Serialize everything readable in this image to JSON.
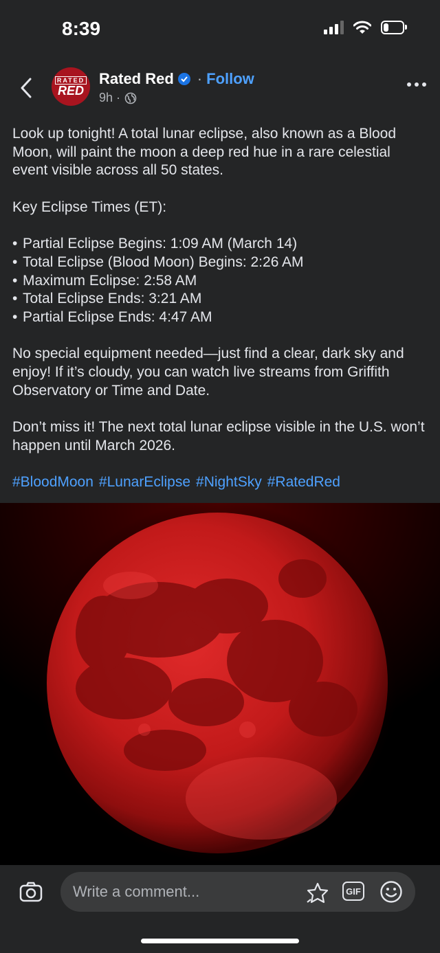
{
  "status_bar": {
    "time": "8:39",
    "battery_level": 0.25
  },
  "header": {
    "avatar_top": "RATED",
    "avatar_bottom": "RED",
    "page_name": "Rated Red",
    "separator": "·",
    "follow_label": "Follow",
    "timestamp": "9h ·",
    "icons": {
      "back": "chevron-left-icon",
      "verified": "verified-badge-icon",
      "audience": "globe-icon",
      "more": "more-dots-icon"
    }
  },
  "post": {
    "intro": "Look up tonight! A total lunar eclipse, also known as a Blood Moon, will paint the moon a deep red hue in a rare celestial event visible across all 50 states.",
    "times_heading": "Key Eclipse Times (ET):",
    "times": [
      "Partial Eclipse Begins: 1:09 AM (March 14)",
      "Total Eclipse (Blood Moon) Begins: 2:26 AM",
      "Maximum Eclipse: 2:58 AM",
      "Total Eclipse Ends: 3:21 AM",
      "Partial Eclipse Ends: 4:47 AM"
    ],
    "advice": "No special equipment needed—just find a clear, dark sky and enjoy! If it’s cloudy, you can watch live streams from Griffith Observatory or Time and Date.",
    "next": "Don’t miss it! The next total lunar eclipse visible in the U.S. won’t happen until March 2026.",
    "hashtags": [
      "#BloodMoon",
      "#LunarEclipse",
      "#NightSky",
      "#RatedRed"
    ]
  },
  "comment_bar": {
    "placeholder": "Write a comment...",
    "gif_label": "GIF",
    "icons": {
      "camera": "camera-icon",
      "sticker": "sticker-icon",
      "gif": "gif-icon",
      "emoji": "emoji-icon"
    }
  },
  "colors": {
    "background": "#242526",
    "link": "#4ea1ff",
    "brand": "#a8141f",
    "moon": "#c21a1a"
  }
}
